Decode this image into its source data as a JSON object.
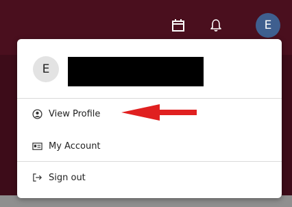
{
  "topbar": {
    "avatar_letter": "E",
    "icons": [
      "calendar-icon",
      "bell-icon"
    ]
  },
  "menu": {
    "avatar_letter": "E",
    "items": [
      {
        "label": "View Profile",
        "icon": "user-circle-icon"
      },
      {
        "label": "My Account",
        "icon": "id-card-icon"
      },
      {
        "label": "Sign out",
        "icon": "sign-out-icon"
      }
    ]
  },
  "colors": {
    "topbar": "#4a0f1e",
    "avatar_top": "#3f5f8f",
    "annotation_arrow": "#e02020"
  }
}
